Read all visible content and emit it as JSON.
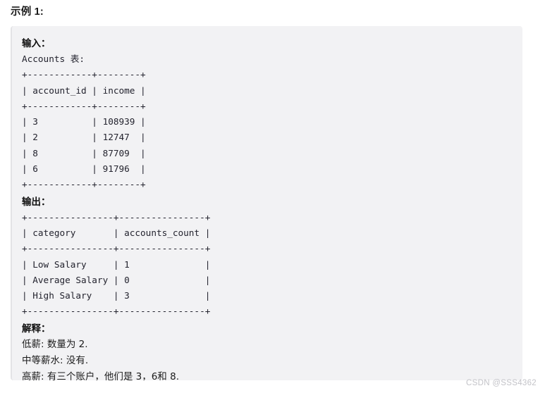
{
  "example": {
    "title": "示例 1:"
  },
  "block": {
    "input_label": "输入：",
    "input_table_name": "Accounts 表:",
    "input_table_text": "+------------+--------+\n| account_id | income |\n+------------+--------+\n| 3          | 108939 |\n| 2          | 12747  |\n| 8          | 87709  |\n| 6          | 91796  |\n+------------+--------+",
    "output_label": "输出：",
    "output_table_text": "+----------------+----------------+\n| category       | accounts_count |\n+----------------+----------------+\n| Low Salary     | 1              |\n| Average Salary | 0              |\n| High Salary    | 3              |\n+----------------+----------------+",
    "explanation_label": "解释：",
    "explanation_lines": [
      "低薪: 数量为 2.",
      "中等薪水: 没有.",
      "高薪: 有三个账户，他们是 3，6和 8."
    ]
  },
  "input_table": {
    "columns": [
      "account_id",
      "income"
    ],
    "rows": [
      [
        "3",
        "108939"
      ],
      [
        "2",
        "12747"
      ],
      [
        "8",
        "87709"
      ],
      [
        "6",
        "91796"
      ]
    ]
  },
  "output_table": {
    "columns": [
      "category",
      "accounts_count"
    ],
    "rows": [
      [
        "Low Salary",
        "1"
      ],
      [
        "Average Salary",
        "0"
      ],
      [
        "High Salary",
        "3"
      ]
    ]
  },
  "watermark": {
    "text": "CSDN @SSS4362"
  },
  "colors": {
    "block_background": "#f2f2f4",
    "block_border": "#e3e3e6",
    "code_text": "#23232e",
    "title_text": "#1a1a1a",
    "watermark_text": "#c3c3c8",
    "page_background": "#ffffff"
  }
}
